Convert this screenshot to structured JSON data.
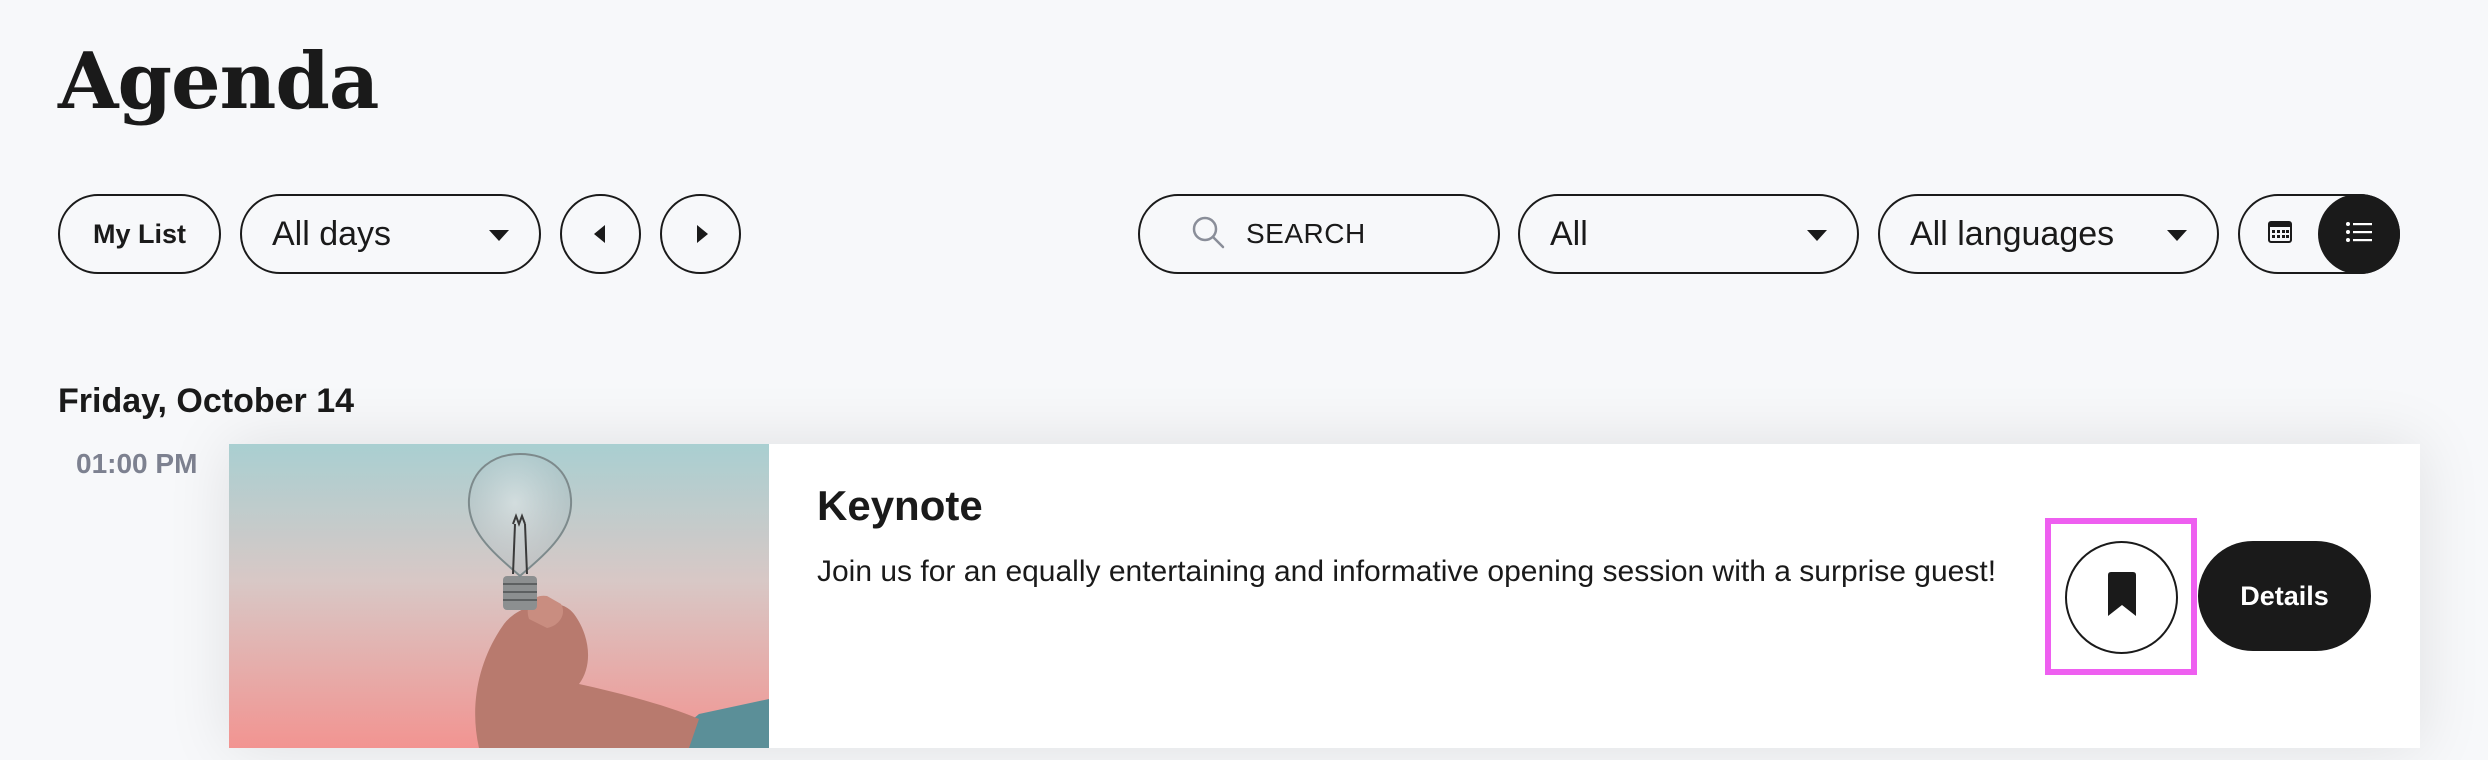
{
  "page": {
    "title": "Agenda"
  },
  "toolbar": {
    "my_list_label": "My List",
    "days_select": {
      "value": "All days"
    },
    "search": {
      "placeholder": "SEARCH"
    },
    "type_select": {
      "value": "All"
    },
    "language_select": {
      "value": "All languages"
    },
    "view_toggle": {
      "active": "list"
    }
  },
  "schedule": {
    "day": "Friday, October 14",
    "sessions": [
      {
        "time": "01:00 PM",
        "title": "Keynote",
        "description": "Join us for an equally entertaining and informative opening session with a surprise guest!",
        "details_label": "Details"
      }
    ]
  },
  "colors": {
    "background": "#f7f8fa",
    "text": "#1a1a1a",
    "muted": "#7d8190",
    "highlight": "#ee5ff0"
  }
}
